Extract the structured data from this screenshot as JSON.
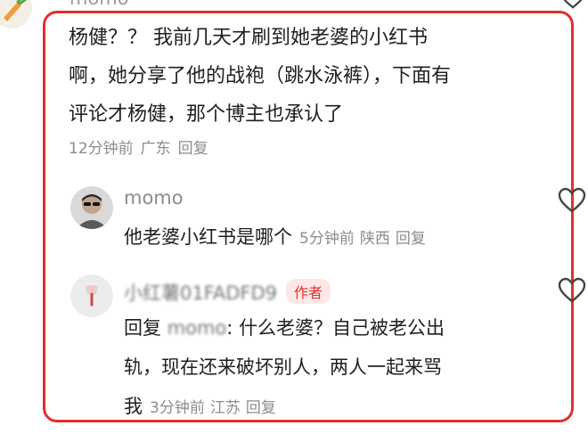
{
  "top_comment": {
    "username": "momo"
  },
  "main_comment": {
    "lines": [
      "杨健？？ 我前几天才刷到她老婆的小红书",
      "啊，她分享了他的战袍（跳水泳裤），下面有",
      "评论才杨健，那个博主也承认了"
    ],
    "time": "12分钟前",
    "location": "广东",
    "reply_label": "回复"
  },
  "reply1": {
    "username": "momo",
    "text": "他老婆小红书是哪个",
    "time": "5分钟前",
    "location": "陕西",
    "reply_label": "回复"
  },
  "reply2": {
    "username": "小红薯01FADFD9",
    "author_badge": "作者",
    "reply_prefix": "回复",
    "mention": "momo",
    "colon": ":",
    "text_line1": "什么老婆？自己被老公出",
    "text_line2": "轨，现在还来破坏别人，两人一起来骂",
    "text_line3": "我",
    "time": "3分钟前",
    "location": "江苏",
    "reply_label": "回复"
  },
  "colors": {
    "highlight": "#e0302c",
    "meta": "#8c8c8c",
    "text": "#1f1f1f"
  }
}
